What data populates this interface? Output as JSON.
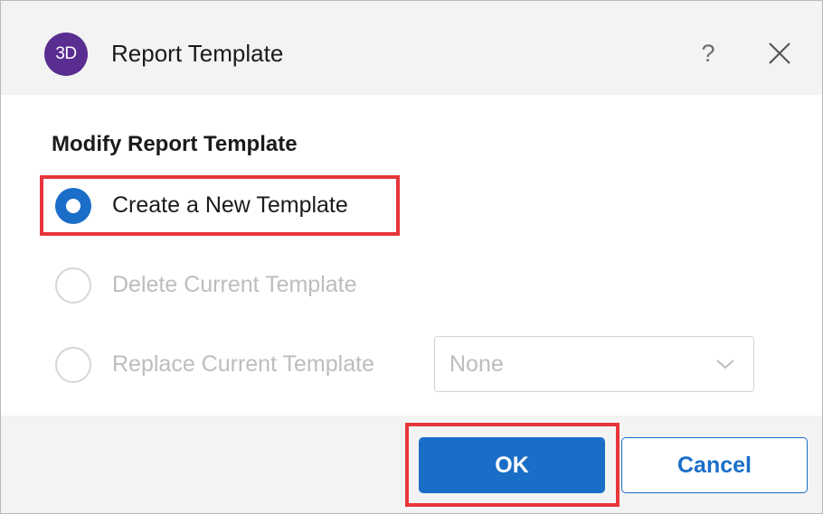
{
  "dialog": {
    "app_logo_text": "3D",
    "title": "Report Template",
    "help_label": "?",
    "close_icon": "close-icon"
  },
  "body": {
    "heading": "Modify Report Template",
    "options": [
      {
        "label": "Create a New Template",
        "checked": true,
        "enabled": true
      },
      {
        "label": "Delete Current Template",
        "checked": false,
        "enabled": false
      },
      {
        "label": "Replace Current Template",
        "checked": false,
        "enabled": false
      }
    ],
    "template_select": {
      "value": "None",
      "enabled": false
    }
  },
  "footer": {
    "ok_label": "OK",
    "cancel_label": "Cancel"
  },
  "colors": {
    "accent": "#1a6ec7",
    "logo": "#5a2d91",
    "highlight": "#e8353b",
    "disabled_text": "#bdbdbd"
  }
}
